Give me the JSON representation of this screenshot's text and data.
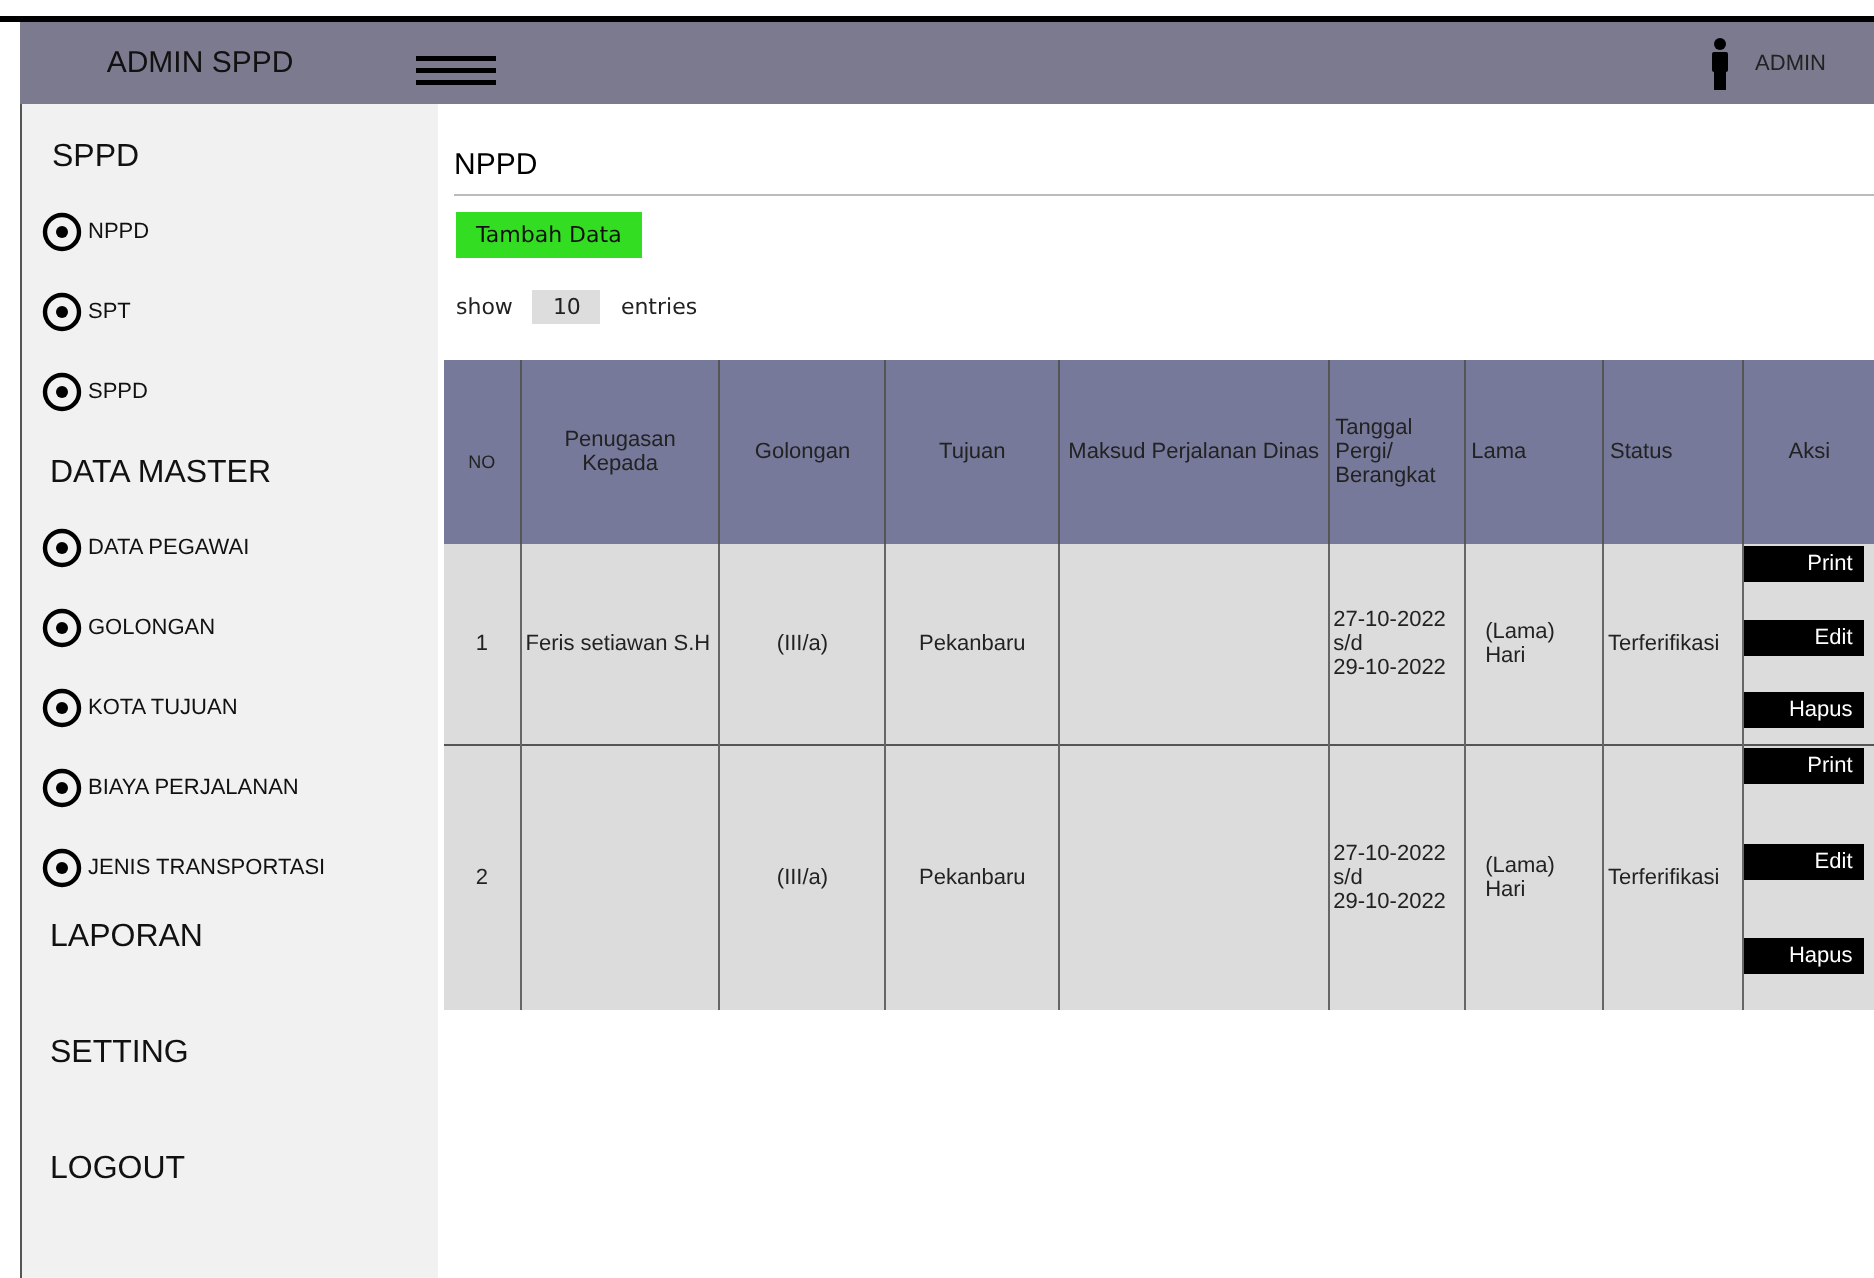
{
  "header": {
    "brand": "ADMIN SPPD",
    "user": "ADMIN"
  },
  "sidebar": {
    "sections": [
      {
        "title": "SPPD",
        "items": [
          {
            "label": "NPPD"
          },
          {
            "label": "SPT"
          },
          {
            "label": "SPPD"
          }
        ]
      },
      {
        "title": "DATA MASTER",
        "items": [
          {
            "label": "DATA PEGAWAI"
          },
          {
            "label": "GOLONGAN"
          },
          {
            "label": "KOTA TUJUAN"
          },
          {
            "label": "BIAYA PERJALANAN"
          },
          {
            "label": "JENIS TRANSPORTASI"
          }
        ]
      },
      {
        "title": "LAPORAN"
      },
      {
        "title": "SETTING"
      },
      {
        "title": "LOGOUT"
      }
    ]
  },
  "page": {
    "title": "NPPD",
    "add_button": "Tambah Data",
    "show_label": "show",
    "entries_value": "10",
    "entries_label": "entries"
  },
  "table": {
    "columns": [
      "NO",
      "Penugasan Kepada",
      "Golongan",
      "Tujuan",
      "Maksud Perjalanan Dinas",
      "Tanggal Pergi/ Berangkat",
      "Lama",
      "Status",
      "Aksi"
    ],
    "rows": [
      {
        "cells": [
          "1",
          "Feris setiawan S.H",
          "(III/a)",
          "Pekanbaru",
          "",
          "27-10-2022\ns/d\n29-10-2022",
          "(Lama) Hari",
          "Terferifikasi"
        ],
        "actions": [
          "Print",
          "Edit",
          "Hapus"
        ]
      },
      {
        "cells": [
          "2",
          "",
          "(III/a)",
          "Pekanbaru",
          "",
          "27-10-2022\ns/d\n29-10-2022",
          "(Lama) Hari",
          "Terferifikasi"
        ],
        "actions": [
          "Print",
          "Edit",
          "Hapus"
        ]
      }
    ]
  }
}
